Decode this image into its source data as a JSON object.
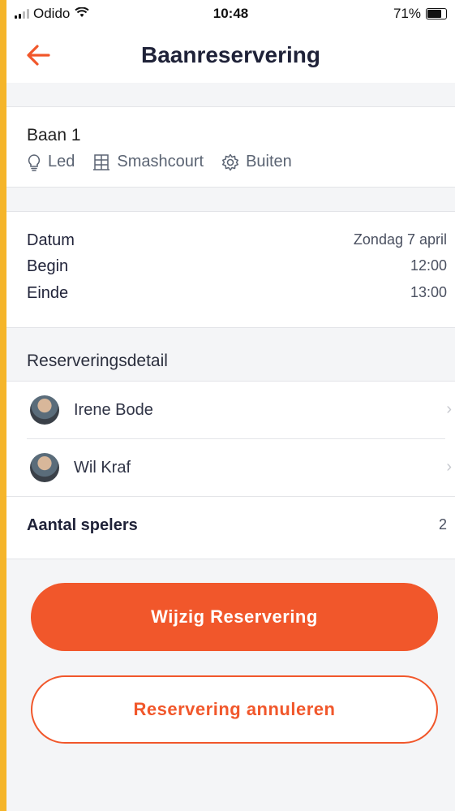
{
  "status_bar": {
    "carrier": "Odido",
    "time": "10:48",
    "battery": "71%"
  },
  "header": {
    "title": "Baanreservering",
    "back_icon": "arrow-left-icon"
  },
  "court": {
    "name": "Baan 1",
    "features": [
      {
        "icon": "lightbulb-icon",
        "label": "Led"
      },
      {
        "icon": "court-icon",
        "label": "Smashcourt"
      },
      {
        "icon": "gear-icon",
        "label": "Buiten"
      }
    ]
  },
  "schedule": {
    "date_label": "Datum",
    "date_value": "Zondag 7 april",
    "start_label": "Begin",
    "start_value": "12:00",
    "end_label": "Einde",
    "end_value": "13:00"
  },
  "details": {
    "title": "Reserveringsdetail",
    "players": [
      {
        "name": "Irene Bode"
      },
      {
        "name": "Wil Kraf"
      }
    ],
    "count_label": "Aantal spelers",
    "count_value": "2"
  },
  "actions": {
    "edit_label": "Wijzig Reservering",
    "cancel_label": "Reservering annuleren"
  },
  "colors": {
    "accent": "#f1572b",
    "frame": "#f5b52a"
  }
}
